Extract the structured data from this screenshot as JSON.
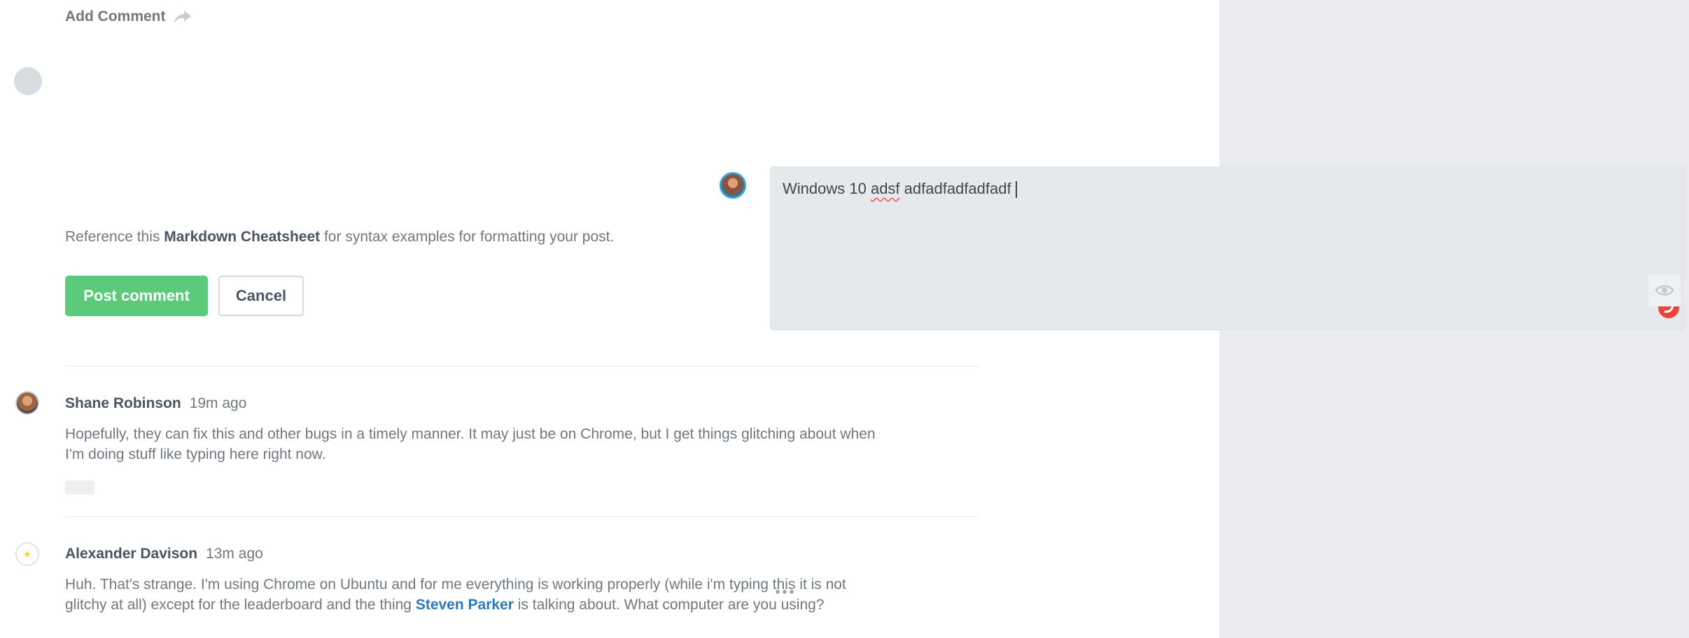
{
  "header": {
    "add_comment_label": "Add Comment",
    "share_icon": "share-arrow-icon"
  },
  "composer": {
    "text": "Windows 10 ",
    "misspelled": "adsf",
    "text_after": " adfadfadfadfadf",
    "preview_icon": "eye-icon",
    "grammar_icon": "grammarly-icon"
  },
  "reference": {
    "prefix": "Reference this ",
    "link": "Markdown Cheatsheet",
    "suffix": " for syntax examples for formatting your post."
  },
  "actions": {
    "post_label": "Post comment",
    "cancel_label": "Cancel"
  },
  "colors": {
    "post_button": "#5bca7b",
    "mention": "#2a7ab8",
    "grammar_badge": "#e5483b",
    "panel_bg": "#e9ebee"
  },
  "comments": [
    {
      "author": "Shane Robinson",
      "time": "19m ago",
      "line1": "Hopefully, they can fix this and other bugs in a timely manner. It may just be on Chrome, but I get things glitching about when",
      "line2": "I'm doing stuff like typing here right now."
    },
    {
      "author": "Alexander Davison",
      "time": "13m ago",
      "line1": "Huh. That's strange. I'm using Chrome on Ubuntu and for me everything is working properly (while i'm typing this it is not",
      "line2_pre": "glitchy at all) except for the leaderboard and the thing ",
      "mention": "Steven Parker",
      "line2_post": " is talking about. What computer are you using?"
    }
  ]
}
